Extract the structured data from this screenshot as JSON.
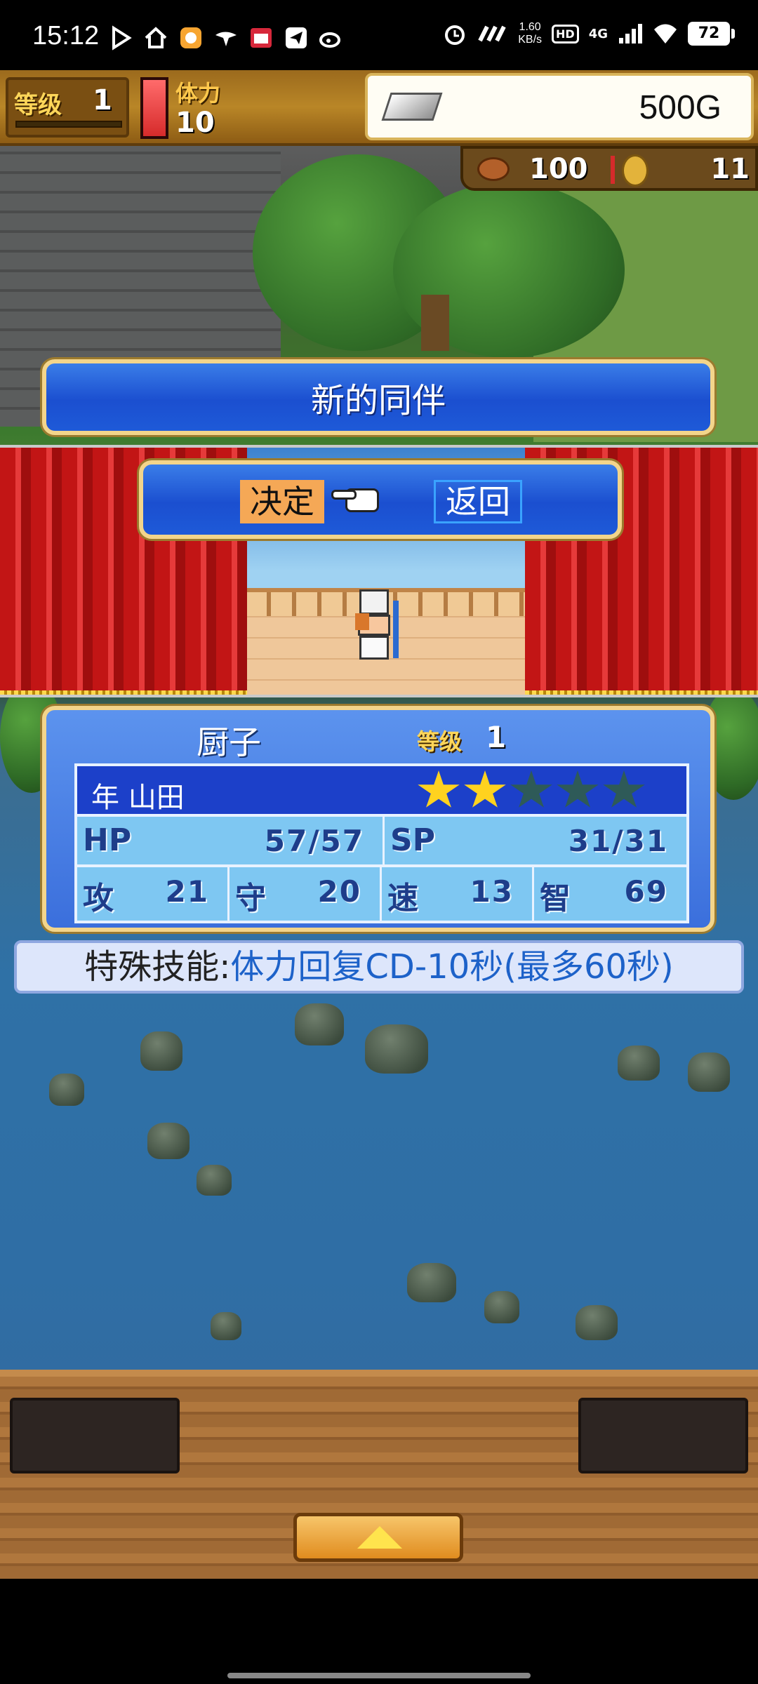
{
  "status_bar": {
    "time": "15:12",
    "left_icons": [
      "play-icon",
      "home-icon",
      "app-icon",
      "bird-icon",
      "calendar-icon",
      "paper-plane-icon",
      "weibo-icon"
    ],
    "speed_value": "1.60",
    "speed_unit": "KB/s",
    "hd": "HD",
    "network": "4G",
    "battery": "72"
  },
  "hud": {
    "level_label": "等级",
    "level_value": "1",
    "stamina_label": "体力",
    "stamina_value": "10",
    "money": "500G",
    "food_value": "100",
    "coin_value": "11"
  },
  "dialog": {
    "title": "新的同伴",
    "confirm_label": "决定",
    "back_label": "返回"
  },
  "character": {
    "class": "厨子",
    "level_label": "等级",
    "level_value": "1",
    "name": "年 山田",
    "stars_filled": 2,
    "stars_total": 5,
    "hp_label": "HP",
    "hp_value": "57/57",
    "sp_label": "SP",
    "sp_value": "31/31",
    "stats": [
      {
        "label": "攻",
        "value": "21"
      },
      {
        "label": "守",
        "value": "20"
      },
      {
        "label": "速",
        "value": "13"
      },
      {
        "label": "智",
        "value": "69"
      }
    ]
  },
  "skill": {
    "label": "特殊技能:",
    "value": "体力回复CD-10秒(最多60秒)"
  },
  "colors": {
    "panel_blue": "#1b4fd0",
    "gold_border": "#f3d58b",
    "confirm_highlight": "#f5a856",
    "skill_text": "#1d62c9"
  }
}
